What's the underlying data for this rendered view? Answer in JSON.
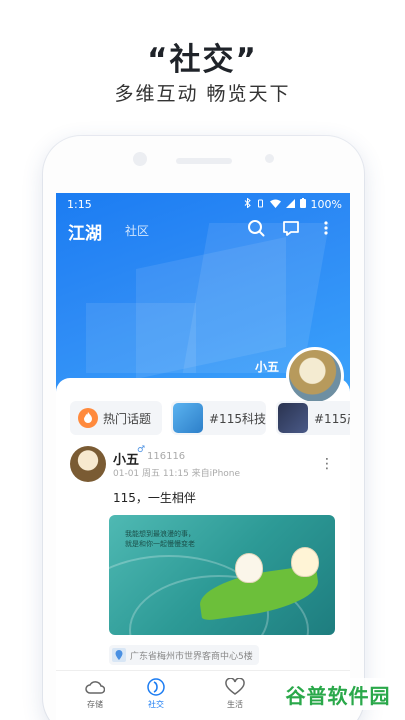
{
  "promo": {
    "title": "“社交”",
    "subtitle": "多维互动  畅览天下"
  },
  "status_bar": {
    "time": "1:15",
    "battery": "100%"
  },
  "app_bar": {
    "title": "江湖",
    "tab": "社区"
  },
  "hero": {
    "user_name": "小五"
  },
  "topics": [
    {
      "label": "热门话题",
      "icon": "fire-icon"
    },
    {
      "label": "#115科技",
      "icon": "topic-thumbnail"
    },
    {
      "label": "#115产",
      "icon": "topic-thumbnail"
    }
  ],
  "post": {
    "author": "小五",
    "uid": "116116",
    "meta": "01-01 周五 11:15  来自iPhone",
    "text": "115，一生相伴",
    "image_caption_line1": "我能想到最浪漫的事，",
    "image_caption_line2": "就是和你一起慢慢变老",
    "location": "广东省梅州市世界客商中心5楼"
  },
  "tabbar": {
    "items": [
      {
        "label": "存储",
        "icon": "cloud-icon",
        "active": false
      },
      {
        "label": "社交",
        "icon": "social-icon",
        "active": true
      },
      {
        "label": "生活",
        "icon": "heart-icon",
        "active": false
      }
    ]
  },
  "watermark": "谷普软件园",
  "colors": {
    "brand_blue": "#1b7cf2",
    "watermark_green": "#2aa84a"
  }
}
